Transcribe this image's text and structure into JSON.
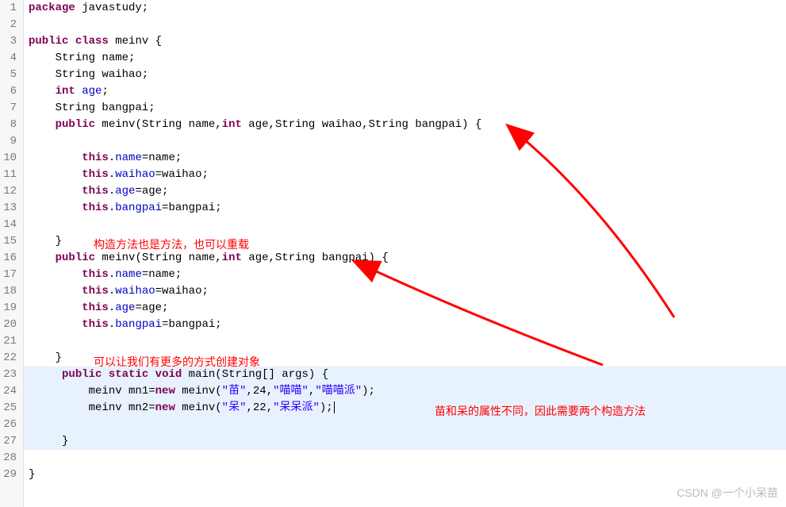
{
  "gutter": [
    "1",
    "2",
    "3",
    "4",
    "5",
    "6",
    "7",
    "8",
    "9",
    "10",
    "11",
    "12",
    "13",
    "14",
    "15",
    "16",
    "17",
    "18",
    "19",
    "20",
    "21",
    "22",
    "23",
    "24",
    "25",
    "26",
    "27",
    "28",
    "29"
  ],
  "code": {
    "l1": {
      "kw1": "package",
      "rest": " javastudy;"
    },
    "l3": {
      "kw1": "public",
      "kw2": "class",
      "name": " meinv {"
    },
    "l4": {
      "indent": "    ",
      "type": "String",
      "rest": " name;"
    },
    "l5": {
      "indent": "    ",
      "type": "String",
      "rest": " waihao;"
    },
    "l6": {
      "indent": "    ",
      "type": "int",
      "rest": " ",
      "field": "age",
      "semi": ";"
    },
    "l7": {
      "indent": "    ",
      "type": "String",
      "rest": " bangpai;"
    },
    "l8": {
      "indent": "    ",
      "kw": "public",
      "rest1": " meinv(String name,",
      "type2": "int",
      "rest2": " age,String waihao,String bangpai) {"
    },
    "l10": {
      "indent": "        ",
      "kw": "this",
      "rest": ".",
      "field": "name",
      "eq": "=name;"
    },
    "l11": {
      "indent": "        ",
      "kw": "this",
      "rest": ".",
      "field": "waihao",
      "eq": "=waihao;"
    },
    "l12": {
      "indent": "        ",
      "kw": "this",
      "rest": ".",
      "field": "age",
      "eq": "=age;"
    },
    "l13": {
      "indent": "        ",
      "kw": "this",
      "rest": ".",
      "field": "bangpai",
      "eq": "=bangpai;"
    },
    "l15": {
      "indent": "    ",
      "brace": "}"
    },
    "l16": {
      "indent": "    ",
      "kw": "public",
      "rest1": " meinv(String name,",
      "type2": "int",
      "rest2": " age,String bangpai) {"
    },
    "l17": {
      "indent": "        ",
      "kw": "this",
      "rest": ".",
      "field": "name",
      "eq": "=name;"
    },
    "l18": {
      "indent": "        ",
      "kw": "this",
      "rest": ".",
      "field": "waihao",
      "eq": "=waihao;"
    },
    "l19": {
      "indent": "        ",
      "kw": "this",
      "rest": ".",
      "field": "age",
      "eq": "=age;"
    },
    "l20": {
      "indent": "        ",
      "kw": "this",
      "rest": ".",
      "field": "bangpai",
      "eq": "=bangpai;"
    },
    "l22": {
      "indent": "    ",
      "brace": "}"
    },
    "l23": {
      "indent": "     ",
      "kw1": "public",
      "sp1": " ",
      "kw2": "static",
      "sp2": " ",
      "kw3": "void",
      "rest": " main(String[] args) {"
    },
    "l24": {
      "indent": "         ",
      "rest1": "meinv mn1=",
      "kw": "new",
      "rest2": " meinv(",
      "s1": "\"苗\"",
      "c1": ",24,",
      "s2": "\"喵喵\"",
      "c2": ",",
      "s3": "\"喵喵派\"",
      "rest3": ");"
    },
    "l25": {
      "indent": "         ",
      "rest1": "meinv mn2=",
      "kw": "new",
      "rest2": " meinv(",
      "s1": "\"呆\"",
      "c1": ",22,",
      "s2": "\"呆呆派\"",
      "rest3": ");"
    },
    "l27": {
      "indent": "     ",
      "brace": "}"
    },
    "l29": {
      "brace": "}"
    }
  },
  "annotations": {
    "a1": "构造方法也是方法，也可以重载",
    "a2": "可以让我们有更多的方式创建对象",
    "a3": "苗和呆的属性不同，因此需要两个构造方法"
  },
  "watermark": "CSDN @一个小呆苗"
}
